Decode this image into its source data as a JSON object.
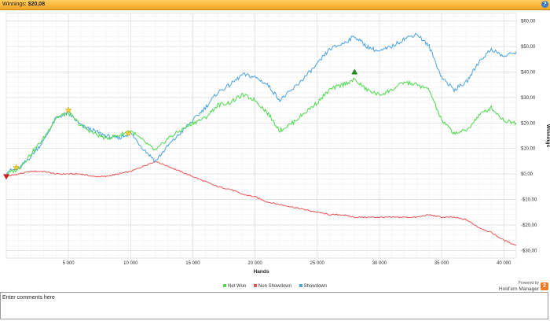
{
  "titlebar": {
    "label": "Winnings:",
    "value": "$20,08",
    "help": "?"
  },
  "legend": {
    "items": [
      {
        "label": "Net Won",
        "color": "#4cd94c"
      },
      {
        "label": "Non Showdown",
        "color": "#e85555"
      },
      {
        "label": "Showdown",
        "color": "#4aa3df"
      }
    ]
  },
  "powered": {
    "line1": "Powered by",
    "line2": "Hold'em Manager",
    "logo": "2"
  },
  "comments": {
    "placeholder": "Enter comments here"
  },
  "colors": {
    "net_won": "#4cd94c",
    "non_showdown": "#e85555",
    "showdown": "#4aa3df",
    "grid": "#e6e6e6",
    "title_bar": "#f5a623"
  },
  "chart_data": {
    "type": "line",
    "xlabel": "Hands",
    "ylabel": "Winnings",
    "xlim": [
      0,
      41000
    ],
    "ylim": [
      -33,
      63
    ],
    "x_ticks": [
      5000,
      10000,
      15000,
      20000,
      25000,
      30000,
      35000,
      40000
    ],
    "x_tick_labels": [
      "5 000",
      "10 000",
      "15 000",
      "20 000",
      "25 000",
      "30 000",
      "35 000",
      "40 000"
    ],
    "y_ticks": [
      60,
      50,
      40,
      30,
      20,
      10,
      0,
      -10,
      -20,
      -30
    ],
    "y_tick_labels": [
      "$60,00",
      "$50,00",
      "$40,00",
      "$30,00",
      "$20,00",
      "$10,00",
      "$0,00",
      "-$10,00",
      "-$20,00",
      "-$30,00"
    ],
    "grid": true,
    "y_axis_side": "right",
    "legend_position": "bottom",
    "x": [
      0,
      1000,
      2000,
      3000,
      4000,
      5000,
      6000,
      7000,
      8000,
      9000,
      10000,
      11000,
      12000,
      13000,
      14000,
      15000,
      16000,
      17000,
      18000,
      19000,
      20000,
      21000,
      22000,
      23000,
      24000,
      25000,
      26000,
      27000,
      28000,
      29000,
      30000,
      31000,
      32000,
      33000,
      34000,
      35000,
      36000,
      37000,
      38000,
      39000,
      40000,
      41000
    ],
    "series": [
      {
        "name": "Net Won",
        "values": [
          0,
          2,
          8,
          14,
          22,
          24,
          19,
          16,
          14,
          15,
          17,
          13,
          9,
          14,
          17,
          20,
          22,
          27,
          28,
          31,
          29,
          24,
          17,
          20,
          24,
          28,
          33,
          35,
          37,
          33,
          31,
          33,
          36,
          35,
          33,
          21,
          16,
          17,
          23,
          26,
          21,
          20
        ]
      },
      {
        "name": "Non Showdown",
        "values": [
          -1,
          0,
          1,
          1,
          0,
          0,
          0,
          -1,
          -1,
          0,
          1,
          3,
          5,
          3,
          1,
          -1,
          -3,
          -5,
          -6,
          -8,
          -9,
          -11,
          -12,
          -13,
          -14,
          -15,
          -16,
          -16,
          -17,
          -17,
          -17,
          -17,
          -17,
          -17,
          -16,
          -17,
          -17,
          -18,
          -21,
          -23,
          -26,
          -28
        ]
      },
      {
        "name": "Showdown",
        "values": [
          1,
          2,
          7,
          13,
          22,
          24,
          19,
          17,
          15,
          14,
          16,
          10,
          5,
          11,
          16,
          21,
          26,
          32,
          35,
          39,
          38,
          35,
          29,
          33,
          38,
          43,
          49,
          51,
          54,
          50,
          48,
          50,
          53,
          55,
          50,
          38,
          33,
          36,
          44,
          49,
          46,
          48
        ]
      }
    ],
    "markers": [
      {
        "label": "red down triangle",
        "x": 0,
        "y": -1,
        "color": "#cc2222"
      },
      {
        "label": "star",
        "x": 800,
        "y": 2.5,
        "color": "#f5d130"
      },
      {
        "label": "star",
        "x": 5000,
        "y": 25,
        "color": "#f5d130"
      },
      {
        "label": "star",
        "x": 9800,
        "y": 16,
        "color": "#f5d130"
      },
      {
        "label": "green up triangle",
        "x": 28000,
        "y": 40,
        "color": "#1e8a1e"
      }
    ]
  }
}
